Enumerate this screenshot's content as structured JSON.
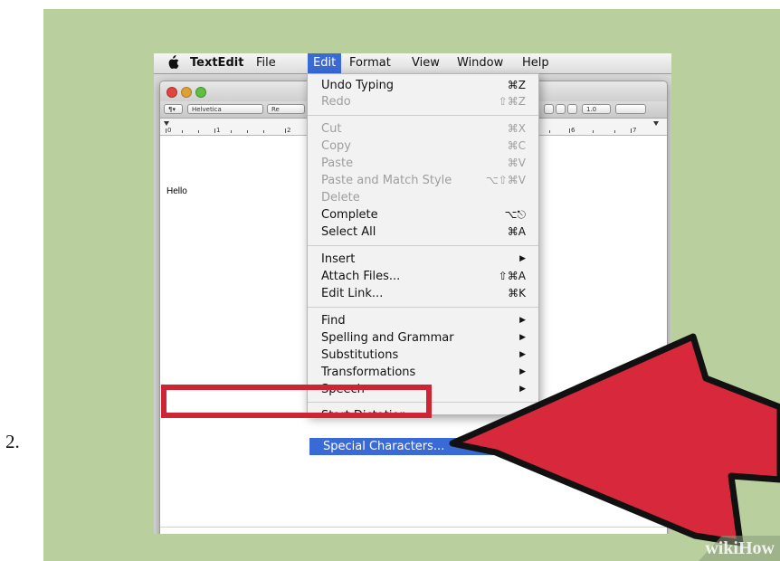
{
  "step_number": "2.",
  "menubar": {
    "apple_icon": "apple-icon",
    "app_name": "TextEdit",
    "items": [
      "File",
      "Edit",
      "Format",
      "View",
      "Window",
      "Help"
    ],
    "active_item": "Edit"
  },
  "toolbar": {
    "paragraph_style": "¶▾",
    "font_family": "Helvetica",
    "font_style": "Re",
    "line_spacing": "1.0"
  },
  "ruler": {
    "numbers": [
      "0",
      "1",
      "2",
      "6",
      "7"
    ]
  },
  "document": {
    "text": "Hello"
  },
  "edit_menu": {
    "items": [
      {
        "label": "Undo Typing",
        "shortcut": "⌘Z",
        "enabled": true
      },
      {
        "label": "Redo",
        "shortcut": "⇧⌘Z",
        "enabled": false
      },
      {
        "label": "Cut",
        "shortcut": "⌘X",
        "enabled": false
      },
      {
        "label": "Copy",
        "shortcut": "⌘C",
        "enabled": false
      },
      {
        "label": "Paste",
        "shortcut": "⌘V",
        "enabled": false
      },
      {
        "label": "Paste and Match Style",
        "shortcut": "⌥⇧⌘V",
        "enabled": false
      },
      {
        "label": "Delete",
        "shortcut": "",
        "enabled": false
      },
      {
        "label": "Complete",
        "shortcut": "⌥⎋",
        "enabled": true
      },
      {
        "label": "Select All",
        "shortcut": "⌘A",
        "enabled": true
      },
      {
        "label": "Insert",
        "shortcut": "",
        "submenu": true,
        "enabled": true
      },
      {
        "label": "Attach Files...",
        "shortcut": "⇧⌘A",
        "enabled": true
      },
      {
        "label": "Edit Link...",
        "shortcut": "⌘K",
        "enabled": true
      },
      {
        "label": "Find",
        "shortcut": "",
        "submenu": true,
        "enabled": true
      },
      {
        "label": "Spelling and Grammar",
        "shortcut": "",
        "submenu": true,
        "enabled": true
      },
      {
        "label": "Substitutions",
        "shortcut": "",
        "submenu": true,
        "enabled": true
      },
      {
        "label": "Transformations",
        "shortcut": "",
        "submenu": true,
        "enabled": true
      },
      {
        "label": "Speech",
        "shortcut": "",
        "submenu": true,
        "enabled": true
      },
      {
        "label": "Start Dictation",
        "shortcut": "",
        "enabled": true
      },
      {
        "label": "Special Characters...",
        "shortcut": "",
        "enabled": true,
        "highlighted": true
      }
    ]
  },
  "annotation": {
    "highlight_color": "#cf2434",
    "arrow_color": "#d8293c",
    "arrow_icon": "red-pointer-arrow"
  },
  "watermark": {
    "text": "wikiHow"
  },
  "colors": {
    "panel_background": "#b9d09e",
    "menu_highlight": "#3a6ad6"
  }
}
